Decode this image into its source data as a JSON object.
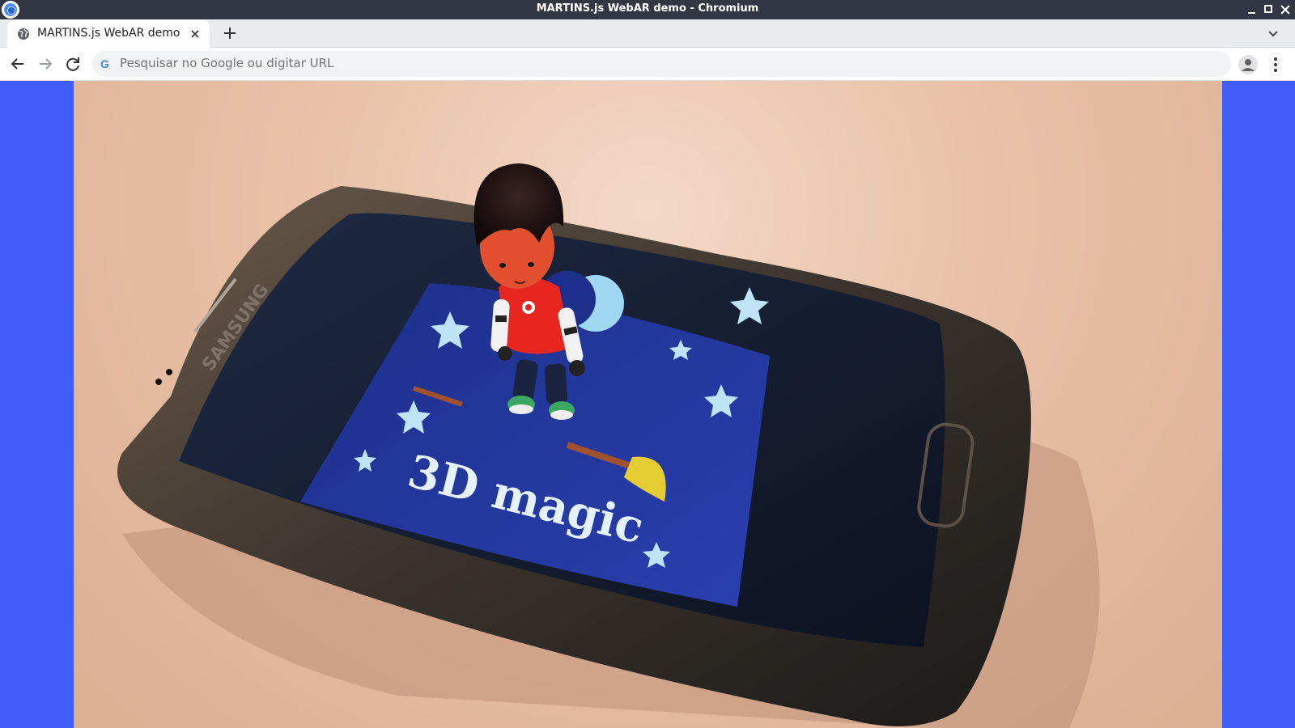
{
  "window": {
    "title": "MARTINS.js WebAR demo - Chromium",
    "controls": [
      "minimize-icon",
      "maximize-icon",
      "close-icon"
    ]
  },
  "tabs": [
    {
      "label": "MARTINS.js WebAR demo",
      "icon": "globe-icon",
      "active": true
    }
  ],
  "toolbar": {
    "omnibox_placeholder": "Pesquisar no Google ou digitar URL",
    "omnibox_value": ""
  },
  "ar_scene": {
    "screen_caption": "3D magic",
    "phone_brand": "SAMSUNG"
  },
  "colors": {
    "page_background": "#3f5cf7",
    "titlebar": "#333743",
    "tabstrip": "#e9ebed"
  }
}
